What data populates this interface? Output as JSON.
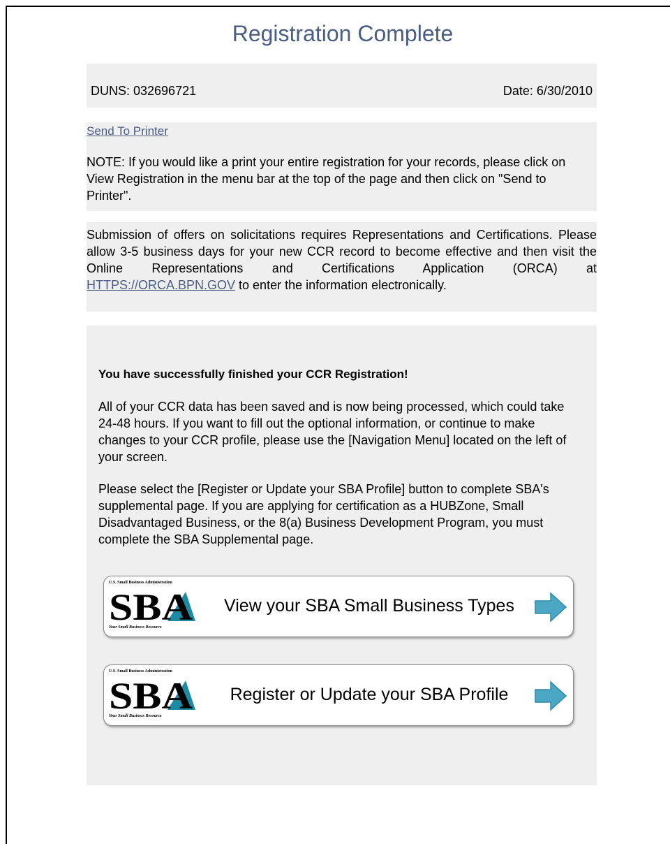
{
  "page": {
    "title": "Registration Complete"
  },
  "header": {
    "duns": "DUNS: 032696721",
    "date": "Date: 6/30/2010"
  },
  "print": {
    "link_label": "Send To Printer",
    "note": "NOTE: If you would like a print your entire registration for your records, please click on View Registration in the menu bar at the top of the page and then click on \"Send to Printer\"."
  },
  "orca": {
    "text_before": "Submission of offers on solicitations requires Representations and Certifications. Please allow 3-5 business days for your new CCR record to become effective and then visit the Online Representations and Certifications Application (ORCA) at ",
    "link_label": "HTTPS://ORCA.BPN.GOV",
    "text_after": " to enter the information electronically."
  },
  "finish": {
    "heading": "You have successfully finished your CCR Registration!",
    "paragraph1": "All of your CCR data has been saved and is now being processed, which could take 24-48 hours. If you want to fill out the optional information, or continue to make changes to your CCR profile, please use the [Navigation Menu] located on the left of your screen.",
    "paragraph2": "Please select the [Register or Update your SBA Profile] button to complete SBA's supplemental page. If you are applying for certification as a HUBZone, Small Disadvantaged Business, or the 8(a) Business Development Program, you must complete the SBA Supplemental page."
  },
  "sba_logo": {
    "top_text": "U.S. Small Business Administration",
    "main_text": "SBA",
    "bottom_text": "Your Small Business Resource"
  },
  "buttons": {
    "view_types": "View your SBA Small Business Types",
    "register_profile": "Register or Update your SBA Profile"
  },
  "colors": {
    "title": "#4a5e84",
    "panel": "#efefef",
    "arrow": "#4ba7c4"
  },
  "icons": {
    "arrow": "right-arrow-icon",
    "logo": "sba-logo"
  }
}
